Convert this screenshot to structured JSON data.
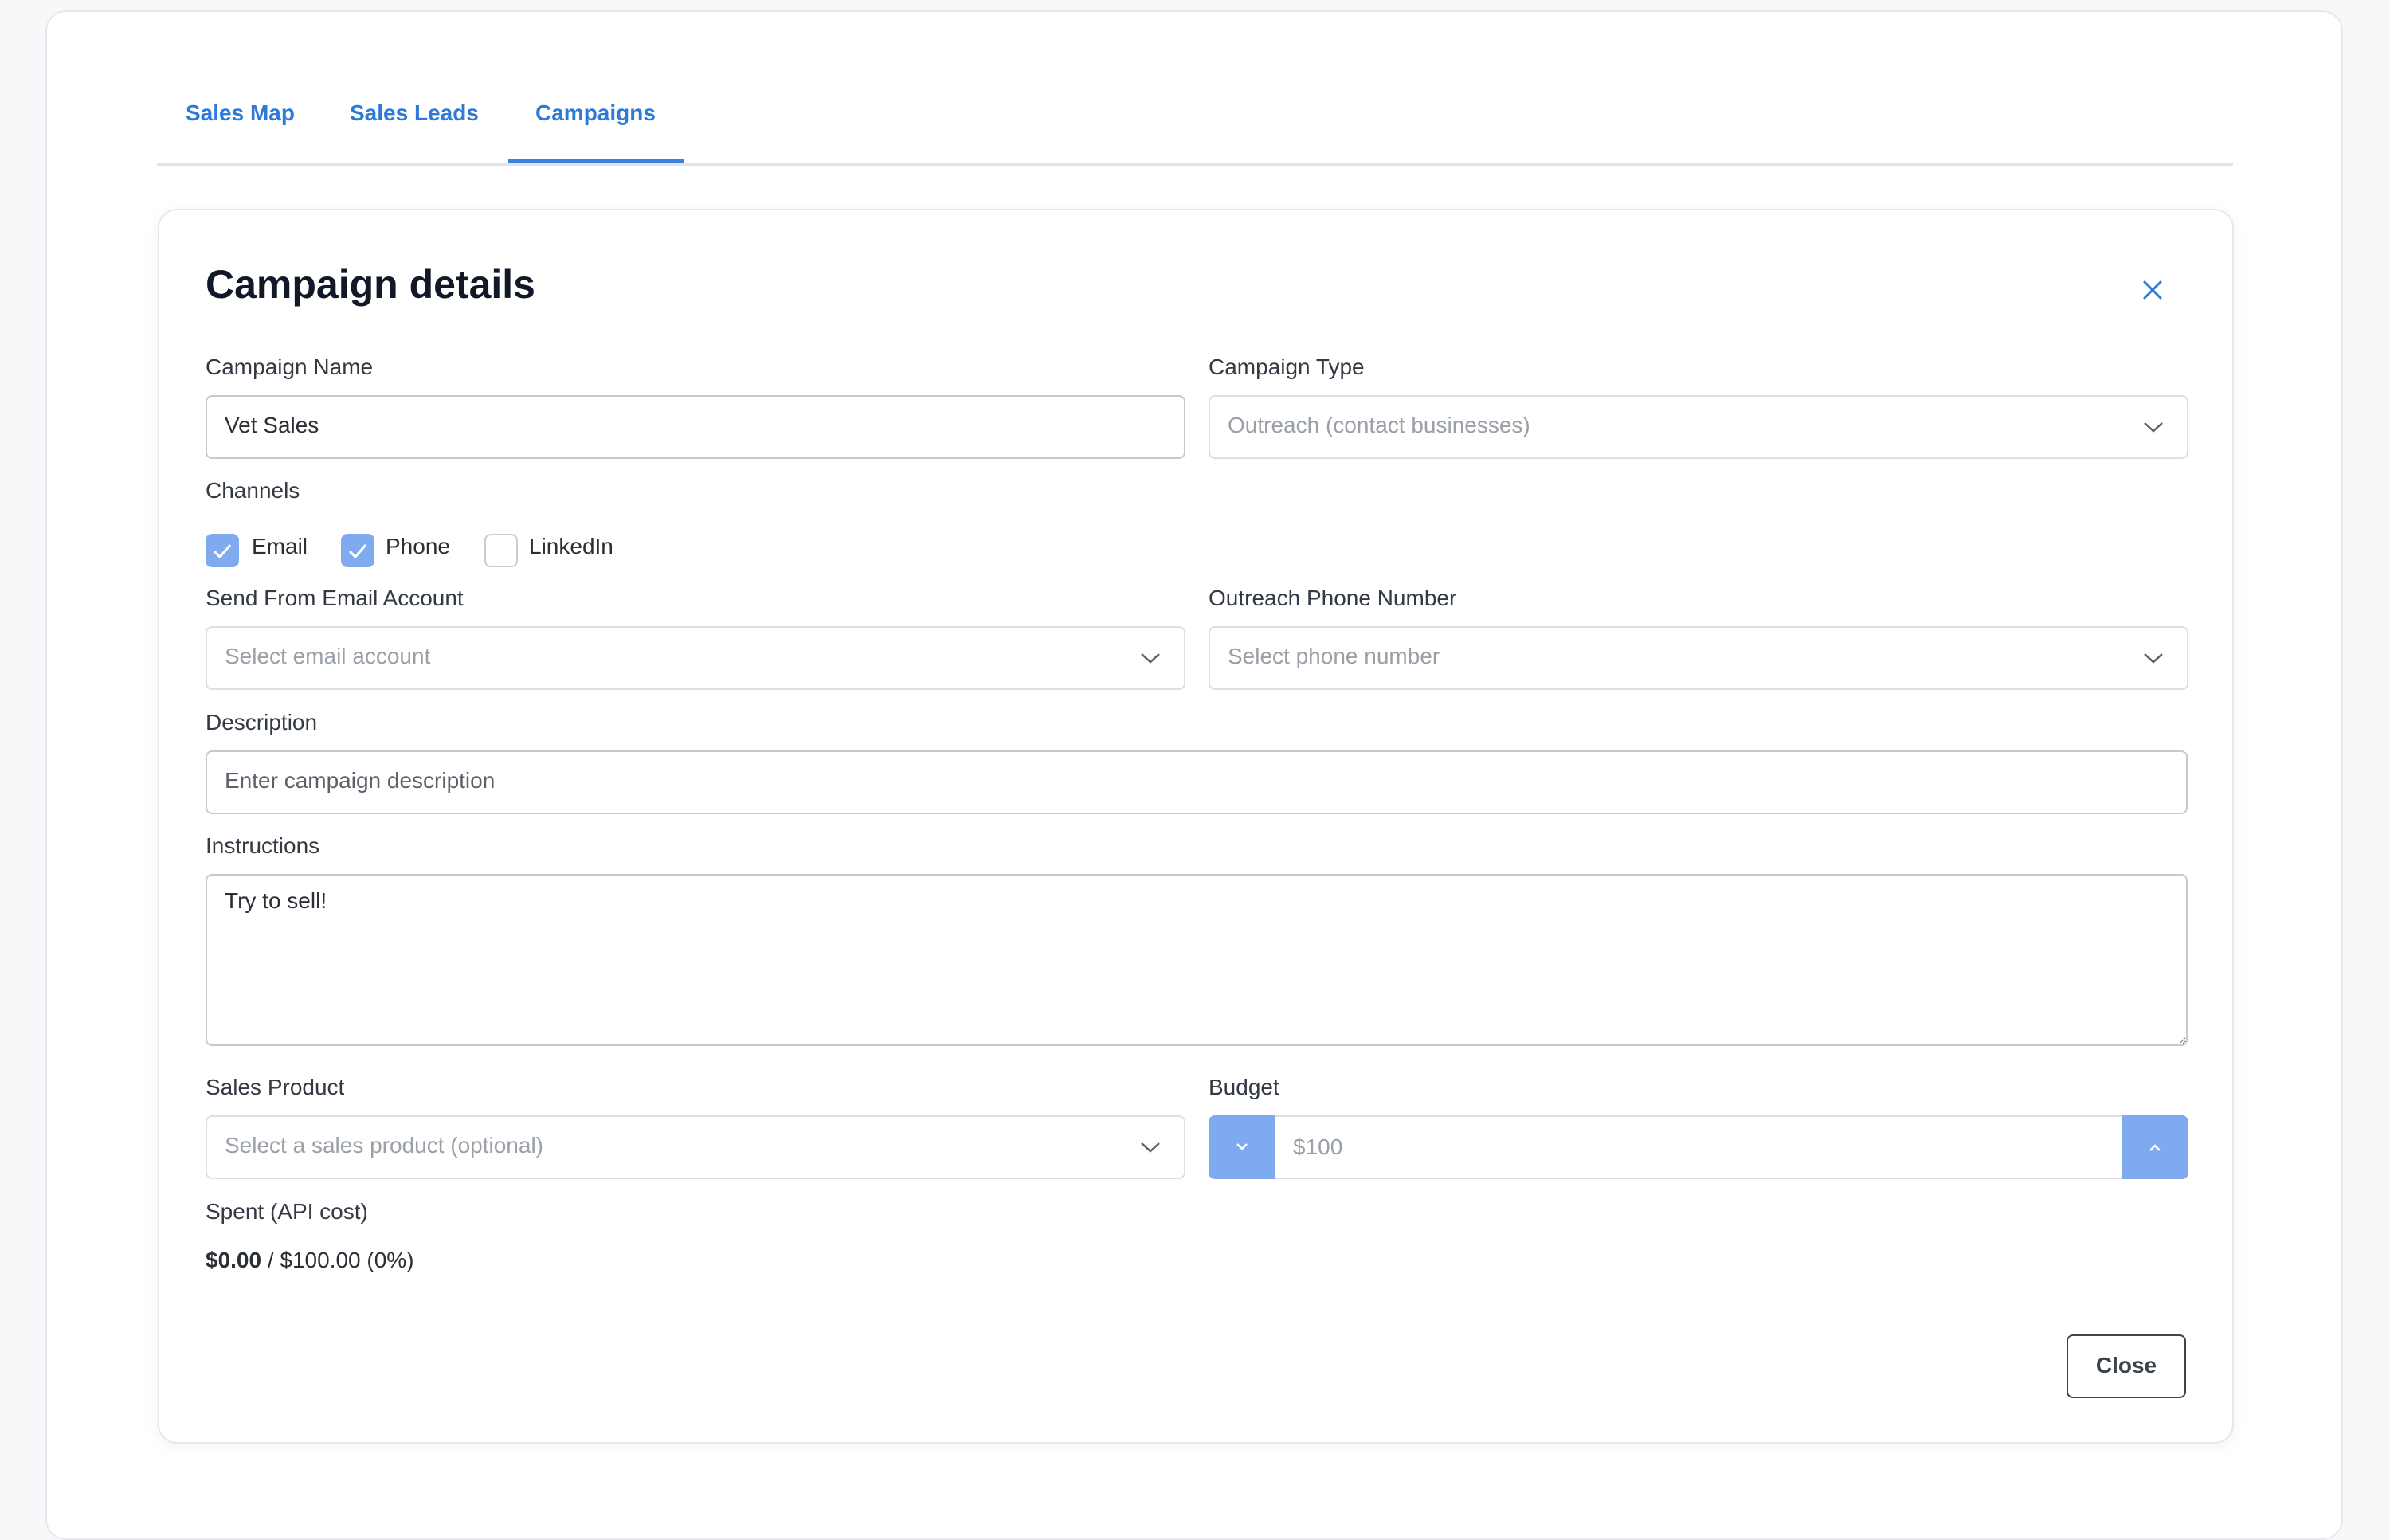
{
  "tabs": [
    {
      "label": "Sales Map"
    },
    {
      "label": "Sales Leads"
    },
    {
      "label": "Campaigns"
    }
  ],
  "active_tab": "Campaigns",
  "card": {
    "title": "Campaign details"
  },
  "form": {
    "campaign_name": {
      "label": "Campaign Name",
      "value": "Vet Sales"
    },
    "campaign_type": {
      "label": "Campaign Type",
      "value": "Outreach (contact businesses)"
    },
    "channels": {
      "label": "Channels",
      "options": [
        {
          "label": "Email",
          "checked": true
        },
        {
          "label": "Phone",
          "checked": true
        },
        {
          "label": "LinkedIn",
          "checked": false
        }
      ]
    },
    "email_account": {
      "label": "Send From Email Account",
      "placeholder": "Select email account"
    },
    "phone_number": {
      "label": "Outreach Phone Number",
      "placeholder": "Select phone number"
    },
    "description": {
      "label": "Description",
      "placeholder": "Enter campaign description"
    },
    "instructions": {
      "label": "Instructions",
      "value": "Try to sell!"
    },
    "sales_product": {
      "label": "Sales Product",
      "placeholder": "Select a sales product (optional)"
    },
    "budget": {
      "label": "Budget",
      "value": "$100"
    },
    "spent": {
      "label": "Spent (API cost)",
      "amount": "$0.00",
      "rest": " / $100.00 (0%)"
    }
  },
  "buttons": {
    "close": "Close"
  },
  "colors": {
    "accent": "#2f7ad9",
    "checkbox_on": "#7faaf0",
    "border": "#dcdfe4"
  }
}
